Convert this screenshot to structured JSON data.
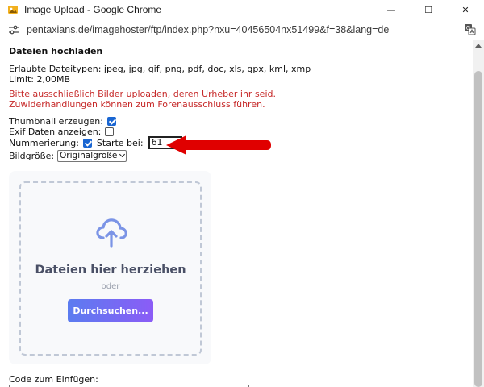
{
  "window": {
    "title": "Image Upload - Google Chrome",
    "controls": {
      "minimize": "—",
      "maximize": "☐",
      "close": "✕"
    }
  },
  "address": {
    "url": "pentaxians.de/imagehoster/ftp/index.php?nxu=40456504nx51499&f=38&lang=de"
  },
  "page": {
    "heading": "Dateien hochladen",
    "filetypes_line": "Erlaubte Dateitypen: jpeg, jpg, gif, png, pdf, doc, xls, gpx, kml, xmp",
    "limit_line": "Limit: 2,00MB",
    "warning_line1": "Bitte ausschließlich Bilder uploaden, deren Urheber ihr seid.",
    "warning_line2": "Zuwiderhandlungen können zum Forenausschluss führen.",
    "warning_color": "#c62828"
  },
  "options": {
    "thumbnail_label": "Thumbnail erzeugen:",
    "thumbnail_checked": true,
    "exif_label": "Exif Daten anzeigen:",
    "exif_checked": false,
    "numbering_label": "Nummerierung:",
    "numbering_checked": true,
    "start_label": "Starte bei:",
    "start_value": "61",
    "size_label": "Bildgröße:",
    "size_value": "Originalgröße"
  },
  "upload": {
    "icon": "cloud-upload-icon",
    "drop_title": "Dateien hier herziehen",
    "or_text": "oder",
    "browse_label": "Durchsuchen...",
    "accent_start": "#5b7cf0",
    "accent_end": "#8b5cf6"
  },
  "code": {
    "label": "Code zum Einfügen:"
  },
  "annotation": {
    "arrow_color": "#e00000"
  }
}
